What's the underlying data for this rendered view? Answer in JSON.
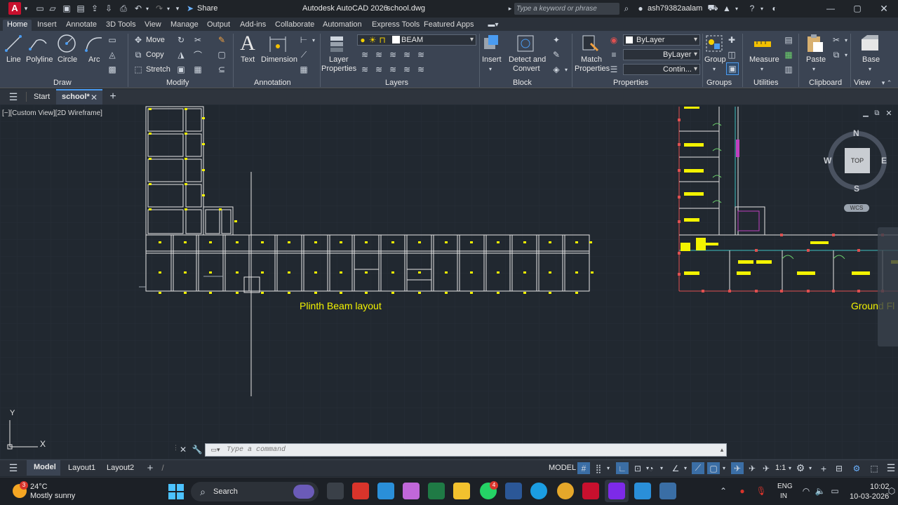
{
  "titlebar": {
    "app_letter": "A",
    "share_label": "Share",
    "title": "Autodesk AutoCAD 2026",
    "filename": "school.dwg",
    "search_placeholder": "Type a keyword or phrase",
    "user": "ash79382aalam"
  },
  "ribbon_tabs": [
    "Home",
    "Insert",
    "Annotate",
    "3D Tools",
    "View",
    "Manage",
    "Output",
    "Add-ins",
    "Collaborate",
    "Automation",
    "Express Tools",
    "Featured Apps"
  ],
  "ribbon": {
    "draw": {
      "line": "Line",
      "polyline": "Polyline",
      "circle": "Circle",
      "arc": "Arc",
      "panel": "Draw"
    },
    "modify": {
      "move": "Move",
      "copy": "Copy",
      "stretch": "Stretch",
      "panel": "Modify"
    },
    "annotation": {
      "text": "Text",
      "dimension": "Dimension",
      "panel": "Annotation"
    },
    "layers": {
      "layer_properties_1": "Layer",
      "layer_properties_2": "Properties",
      "current_layer": "BEAM",
      "panel": "Layers"
    },
    "block": {
      "insert": "Insert",
      "detect_1": "Detect and",
      "detect_2": "Convert",
      "panel": "Block"
    },
    "properties": {
      "match_1": "Match",
      "match_2": "Properties",
      "color": "ByLayer",
      "linetype": "ByLayer",
      "lineweight": "Contin...",
      "panel": "Properties"
    },
    "groups": {
      "group": "Group",
      "panel": "Groups"
    },
    "utilities": {
      "measure": "Measure",
      "panel": "Utilities"
    },
    "clipboard": {
      "paste": "Paste",
      "panel": "Clipboard"
    },
    "view": {
      "base": "Base",
      "panel": "View"
    }
  },
  "doc_tabs": {
    "start": "Start",
    "school": "school*"
  },
  "viewport": {
    "label": "[−][Custom View][2D Wireframe]",
    "plinth_label": "Plinth Beam layout",
    "ground_label": "Ground Fl",
    "compass": {
      "n": "N",
      "s": "S",
      "e": "E",
      "w": "W",
      "top": "TOP",
      "wcs": "WCS"
    },
    "ucs_y": "Y",
    "ucs_x": "X"
  },
  "command": {
    "placeholder": "Type a command"
  },
  "layout_tabs": [
    "Model",
    "Layout1",
    "Layout2"
  ],
  "status": {
    "model": "MODEL",
    "scale": "1:1"
  },
  "taskbar": {
    "temp": "24°C",
    "weather": "Mostly sunny",
    "weather_badge": "3",
    "search": "Search",
    "whatsapp_badge": "4",
    "lang1": "ENG",
    "lang2": "IN",
    "time": "10:02",
    "date": "10-03-2026"
  },
  "colors": {
    "accent": "#2a7de1",
    "canvas": "#212830",
    "yellow": "#f3f300",
    "beam": "#e6e6e6"
  }
}
